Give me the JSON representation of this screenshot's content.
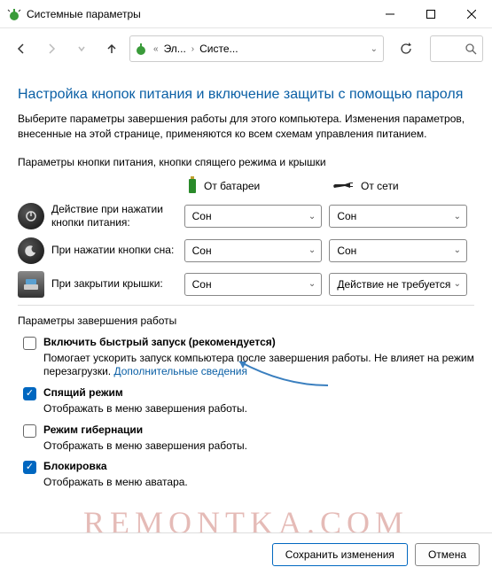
{
  "window": {
    "title": "Системные параметры"
  },
  "breadcrumb": {
    "item1": "Эл...",
    "item2": "Систе..."
  },
  "heading": "Настройка кнопок питания и включение защиты с помощью пароля",
  "description": "Выберите параметры завершения работы для этого компьютера. Изменения параметров, внесенные на этой странице, применяются ко всем схемам управления питанием.",
  "powerButtonsLabel": "Параметры кнопки питания, кнопки спящего режима и крышки",
  "columns": {
    "battery": "От батареи",
    "plugged": "От сети"
  },
  "rows": {
    "power": {
      "label": "Действие при нажатии кнопки питания:",
      "battery": "Сон",
      "plugged": "Сон"
    },
    "sleep": {
      "label": "При нажатии кнопки сна:",
      "battery": "Сон",
      "plugged": "Сон"
    },
    "lid": {
      "label": "При закрытии крышки:",
      "battery": "Сон",
      "plugged": "Действие не требуется"
    }
  },
  "shutdownLabel": "Параметры завершения работы",
  "opts": {
    "fastboot": {
      "title": "Включить быстрый запуск (рекомендуется)",
      "desc": "Помогает ускорить запуск компьютера после завершения работы. Не влияет на режим перезагрузки. ",
      "link": "Дополнительные сведения"
    },
    "sleep": {
      "title": "Спящий режим",
      "desc": "Отображать в меню завершения работы."
    },
    "hiber": {
      "title": "Режим гибернации",
      "desc": "Отображать в меню завершения работы."
    },
    "lock": {
      "title": "Блокировка",
      "desc": "Отображать в меню аватара."
    }
  },
  "buttons": {
    "save": "Сохранить изменения",
    "cancel": "Отмена"
  },
  "watermark": "REMONTKA.COM"
}
